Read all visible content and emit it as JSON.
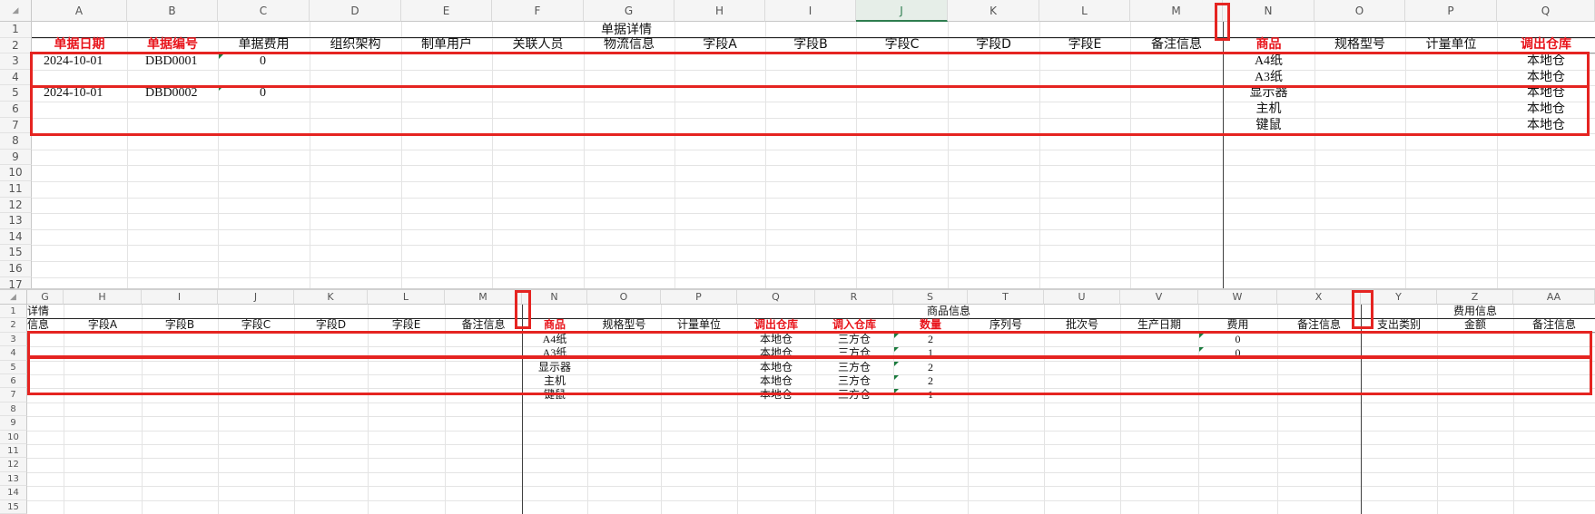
{
  "top_pane": {
    "columns": [
      "A",
      "B",
      "C",
      "D",
      "E",
      "F",
      "G",
      "H",
      "I",
      "J",
      "K",
      "L",
      "M",
      "N",
      "O",
      "P",
      "Q"
    ],
    "selected_column": "J",
    "rows": [
      "1",
      "2",
      "3",
      "4",
      "5",
      "6",
      "7",
      "8",
      "9",
      "10",
      "11",
      "12",
      "13",
      "14",
      "15",
      "16",
      "17"
    ],
    "title": "单据详情",
    "headers": [
      "单据日期",
      "单据编号",
      "单据费用",
      "组织架构",
      "制单用户",
      "关联人员",
      "物流信息",
      "字段A",
      "字段B",
      "字段C",
      "字段D",
      "字段E",
      "备注信息",
      "商品",
      "规格型号",
      "计量单位",
      "调出仓库"
    ],
    "records": [
      {
        "date": "2024-10-01",
        "code": "DBD0001",
        "fee": "0",
        "items": [
          {
            "product": "A4纸",
            "warehouse": "本地仓"
          },
          {
            "product": "A3纸",
            "warehouse": "本地仓"
          }
        ]
      },
      {
        "date": "2024-10-01",
        "code": "DBD0002",
        "fee": "0",
        "items": [
          {
            "product": "显示器",
            "warehouse": "本地仓"
          },
          {
            "product": "主机",
            "warehouse": "本地仓"
          },
          {
            "product": "键鼠",
            "warehouse": "本地仓"
          }
        ]
      }
    ]
  },
  "bottom_pane": {
    "columns": [
      "G",
      "H",
      "I",
      "J",
      "K",
      "L",
      "M",
      "N",
      "O",
      "P",
      "Q",
      "R",
      "S",
      "T",
      "U",
      "V",
      "W",
      "X",
      "Y",
      "Z",
      "AA"
    ],
    "rows": [
      "1",
      "2",
      "3",
      "4",
      "5",
      "6",
      "7",
      "8",
      "9",
      "10",
      "11",
      "12",
      "13",
      "14",
      "15"
    ],
    "title_partial": "详情",
    "group_product": "商品信息",
    "group_fee": "费用信息",
    "left_partial_header": "信息",
    "headers": [
      "字段A",
      "字段B",
      "字段C",
      "字段D",
      "字段E",
      "备注信息",
      "商品",
      "规格型号",
      "计量单位",
      "调出仓库",
      "调入仓库",
      "数量",
      "序列号",
      "批次号",
      "生产日期",
      "费用",
      "备注信息",
      "支出类别",
      "金额",
      "备注信息"
    ],
    "items": [
      {
        "product": "A4纸",
        "out": "本地仓",
        "in": "三方仓",
        "qty": "2",
        "fee": "0"
      },
      {
        "product": "A3纸",
        "out": "本地仓",
        "in": "三方仓",
        "qty": "1",
        "fee": "0"
      },
      {
        "product": "显示器",
        "out": "本地仓",
        "in": "三方仓",
        "qty": "2",
        "fee": ""
      },
      {
        "product": "主机",
        "out": "本地仓",
        "in": "三方仓",
        "qty": "2",
        "fee": ""
      },
      {
        "product": "键鼠",
        "out": "本地仓",
        "in": "三方仓",
        "qty": "1",
        "fee": ""
      }
    ]
  },
  "colors": {
    "highlight_red": "#e52421",
    "header_red": "#e8141b",
    "selected_green": "#2e7d4f"
  }
}
